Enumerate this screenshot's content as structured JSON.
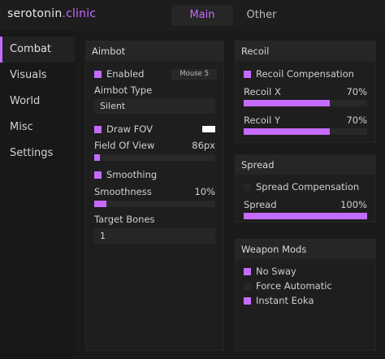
{
  "brand": {
    "name": "serotonin",
    "suffix": ".clinic"
  },
  "tabs": [
    {
      "label": "Main"
    },
    {
      "label": "Other"
    }
  ],
  "sidebar": {
    "items": [
      {
        "label": "Combat"
      },
      {
        "label": "Visuals"
      },
      {
        "label": "World"
      },
      {
        "label": "Misc"
      },
      {
        "label": "Settings"
      }
    ]
  },
  "aimbot": {
    "title": "Aimbot",
    "enabled_label": "Enabled",
    "enabled": true,
    "keybind": "Mouse 5",
    "type_label": "Aimbot Type",
    "type_value": "Silent",
    "draw_fov_label": "Draw FOV",
    "draw_fov": true,
    "fov_color": "#ffffff",
    "fov_label": "Field Of View",
    "fov_value": "86px",
    "fov_fill": 0.05,
    "smoothing_label": "Smoothing",
    "smoothing": true,
    "smoothness_label": "Smoothness",
    "smoothness_value": "10%",
    "smoothness_fill": 0.1,
    "bones_label": "Target Bones",
    "bones_value": "1"
  },
  "recoil": {
    "title": "Recoil",
    "comp_label": "Recoil Compensation",
    "comp": true,
    "x_label": "Recoil X",
    "x_value": "70%",
    "x_fill": 0.7,
    "y_label": "Recoil Y",
    "y_value": "70%",
    "y_fill": 0.7
  },
  "spread": {
    "title": "Spread",
    "comp_label": "Spread Compensation",
    "comp": false,
    "label": "Spread",
    "value": "100%",
    "fill": 1.0
  },
  "weapon_mods": {
    "title": "Weapon Mods",
    "items": [
      {
        "label": "No Sway",
        "checked": true
      },
      {
        "label": "Force Automatic",
        "checked": false
      },
      {
        "label": "Instant Eoka",
        "checked": true
      }
    ]
  },
  "colors": {
    "accent": "#c56bff"
  }
}
